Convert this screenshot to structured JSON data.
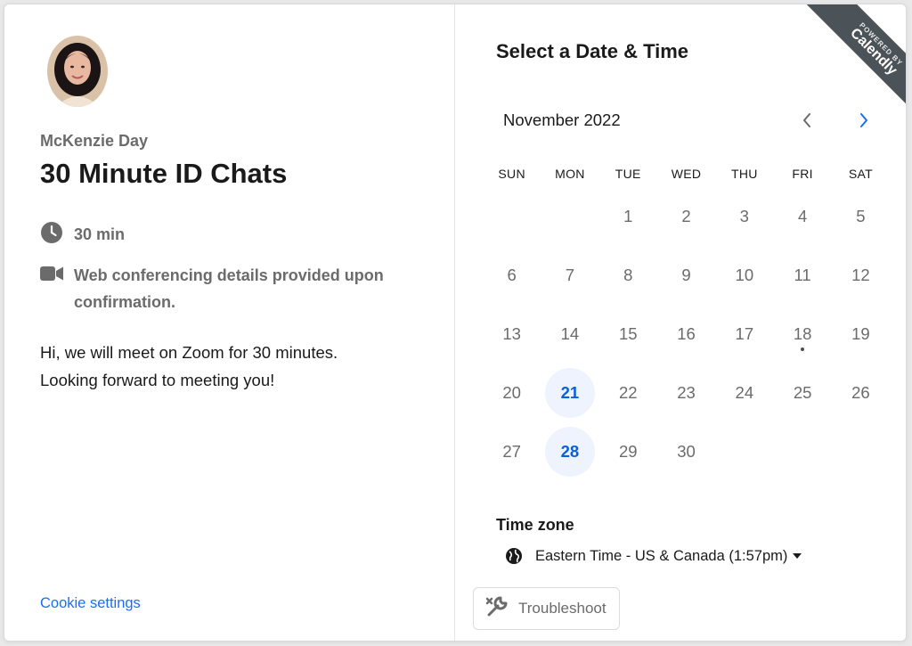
{
  "host": {
    "name": "McKenzie Day"
  },
  "event": {
    "title": "30 Minute ID Chats",
    "duration": "30 min",
    "location_line1": "Web conferencing details provided upon",
    "location_line2": "confirmation.",
    "description_line1": "Hi, we will meet on Zoom for 30 minutes.",
    "description_line2": "Looking forward to meeting you!"
  },
  "footer": {
    "cookie_settings": "Cookie settings"
  },
  "calendar": {
    "heading": "Select a Date & Time",
    "month_label": "November 2022",
    "weekdays": [
      "SUN",
      "MON",
      "TUE",
      "WED",
      "THU",
      "FRI",
      "SAT"
    ],
    "first_weekday_index": 2,
    "days_in_month": 30,
    "available_days": [
      21,
      28
    ],
    "today": 18,
    "colors": {
      "accent": "#0b5fdc",
      "available_bg": "#eef3fe",
      "link": "#1c6ef2"
    }
  },
  "timezone": {
    "label": "Time zone",
    "value": "Eastern Time - US & Canada (1:57pm)"
  },
  "troubleshoot": {
    "label": "Troubleshoot"
  },
  "ribbon": {
    "powered_by": "POWERED BY",
    "brand": "Calendly"
  },
  "icons": {
    "clock": "clock-icon",
    "video": "video-camera-icon",
    "globe": "globe-icon",
    "prev": "chevron-left-icon",
    "next": "chevron-right-icon",
    "wrench": "wrench-icon"
  }
}
